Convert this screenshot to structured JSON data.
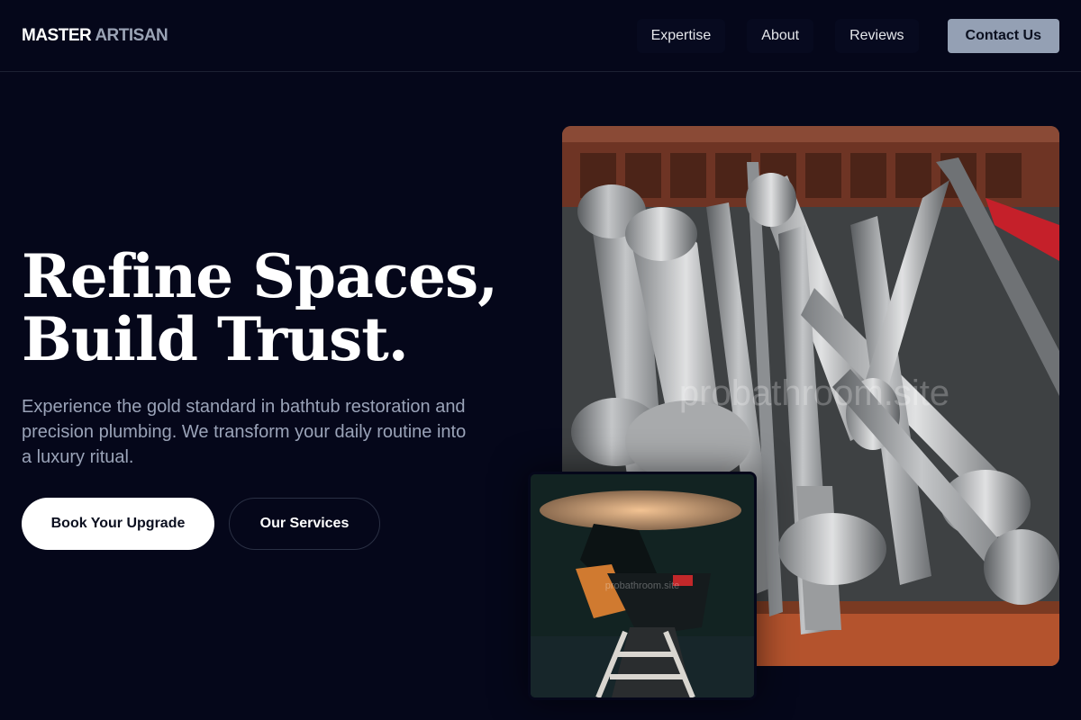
{
  "header": {
    "logo_part1": "MASTER",
    "logo_part2": "ARTISAN",
    "nav": [
      {
        "label": "Expertise"
      },
      {
        "label": "About"
      },
      {
        "label": "Reviews"
      }
    ],
    "contact_label": "Contact Us"
  },
  "hero": {
    "title_line1": "Refine Spaces,",
    "title_line2": "Build Trust.",
    "subtitle": "Experience the gold standard in bathtub restoration and precision plumbing. We transform your daily routine into a luxury ritual.",
    "primary_button": "Book Your Upgrade",
    "secondary_button": "Our Services"
  },
  "images": {
    "main_watermark": "probathroom.site",
    "small_watermark": "probathroom.site"
  },
  "colors": {
    "background": "#05071a",
    "accent_button": "#94a0b4",
    "muted_text": "#9aa3b8"
  }
}
